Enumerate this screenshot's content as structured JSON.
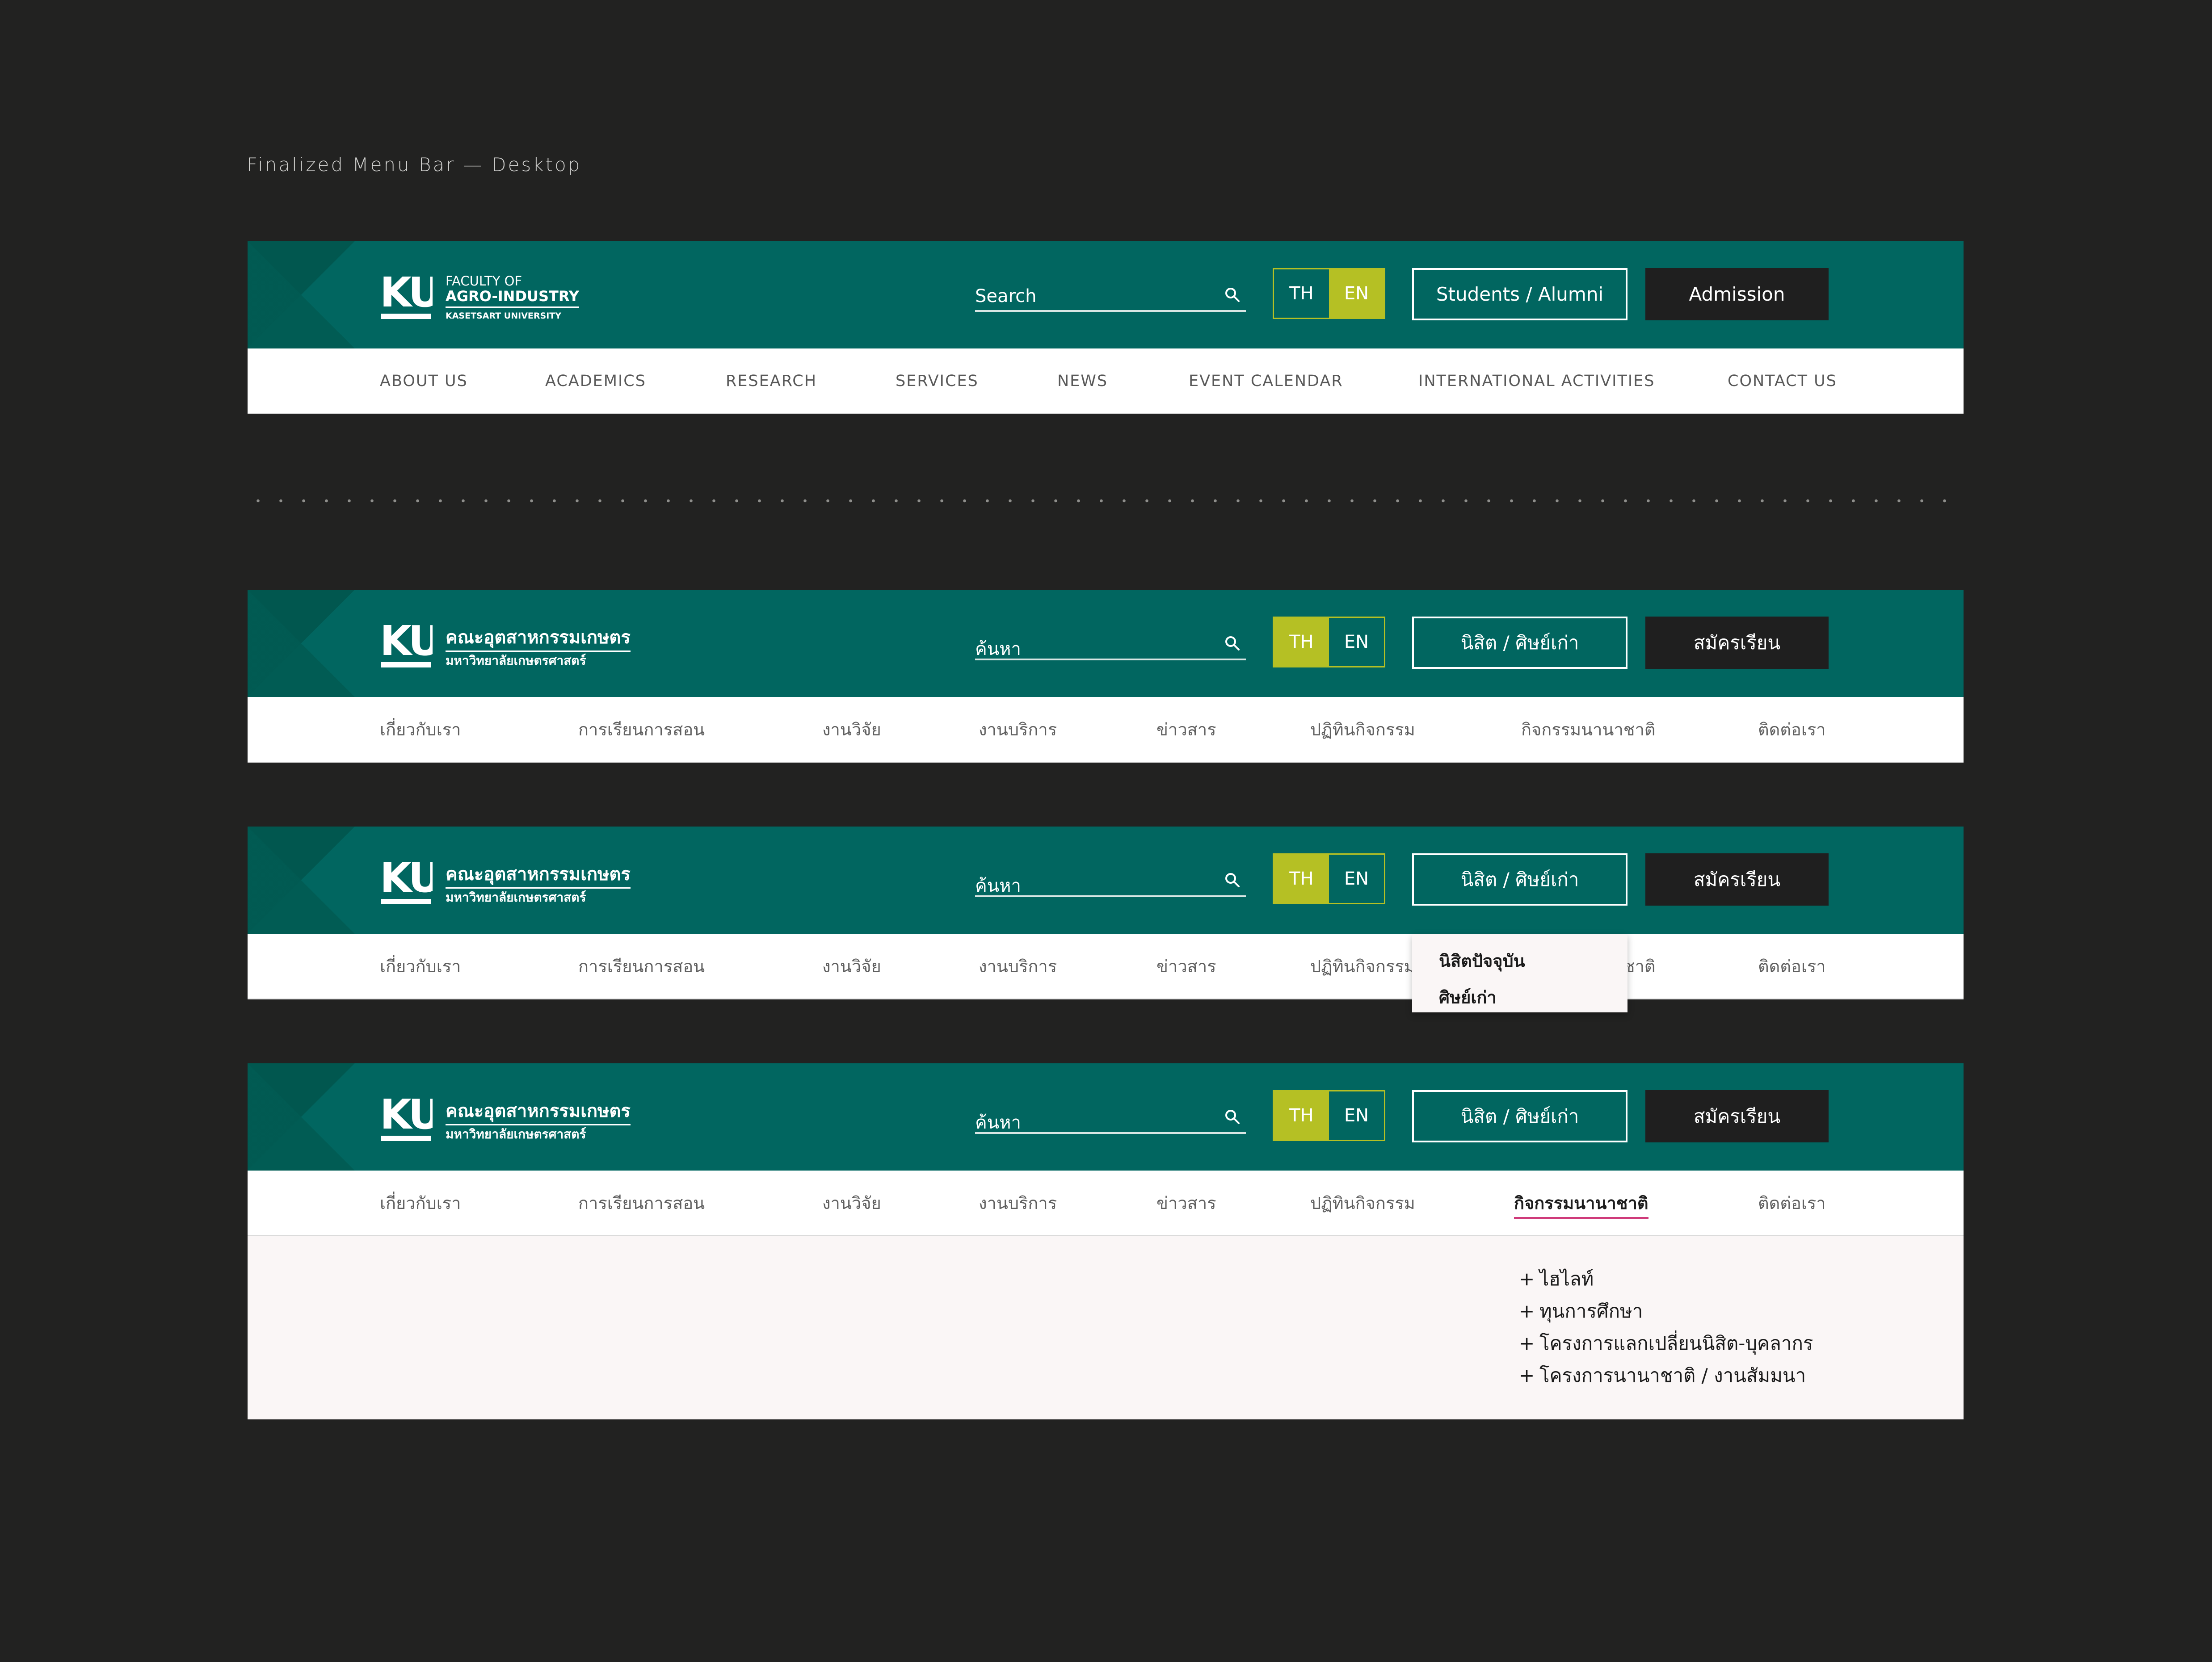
{
  "caption": "Finalized Menu Bar — Desktop",
  "colors": {
    "page_bg": "#222221",
    "header_bg": "#016660",
    "accent_lime": "#b5c024",
    "dark_button": "#1f1f1f",
    "active_underline": "#cf3a7a",
    "dropdown_bg": "#faf6f6"
  },
  "logo": {
    "mark": "KU"
  },
  "bars": [
    {
      "lang": "en",
      "logo_lines": [
        "FACULTY OF",
        "AGRO-INDUSTRY",
        "KASETSART UNIVERSITY"
      ],
      "search_placeholder": "Search",
      "lang_toggle": {
        "th": "TH",
        "en": "EN",
        "active": "EN"
      },
      "secondary_button": "Students / Alumni",
      "primary_button": "Admission",
      "nav": [
        "ABOUT US",
        "ACADEMICS",
        "RESEARCH",
        "SERVICES",
        "NEWS",
        "EVENT CALENDAR",
        "INTERNATIONAL ACTIVITIES",
        "CONTACT US"
      ]
    },
    {
      "lang": "th",
      "logo_lines": [
        "คณะอุตสาหกรรมเกษตร",
        "มหาวิทยาลัยเกษตรศาสตร์"
      ],
      "search_placeholder": "ค้นหา",
      "lang_toggle": {
        "th": "TH",
        "en": "EN",
        "active": "TH"
      },
      "secondary_button": "นิสิต / ศิษย์เก่า",
      "primary_button": "สมัครเรียน",
      "nav": [
        "เกี่ยวกับเรา",
        "การเรียนการสอน",
        "งานวิจัย",
        "งานบริการ",
        "ข่าวสาร",
        "ปฏิทินกิจกรรม",
        "กิจกรรมนานาชาติ",
        "ติดต่อเรา"
      ]
    },
    {
      "lang": "th",
      "logo_lines": [
        "คณะอุตสาหกรรมเกษตร",
        "มหาวิทยาลัยเกษตรศาสตร์"
      ],
      "search_placeholder": "ค้นหา",
      "lang_toggle": {
        "th": "TH",
        "en": "EN",
        "active": "TH"
      },
      "secondary_button": "นิสิต / ศิษย์เก่า",
      "primary_button": "สมัครเรียน",
      "nav": [
        "เกี่ยวกับเรา",
        "การเรียนการสอน",
        "งานวิจัย",
        "งานบริการ",
        "ข่าวสาร",
        "ปฏิทินกิจกรรม",
        "กิจกรรมนานาชาติ",
        "ติดต่อเรา"
      ],
      "dropdown": [
        "นิสิตปัจจุบัน",
        "ศิษย์เก่า"
      ]
    },
    {
      "lang": "th",
      "logo_lines": [
        "คณะอุตสาหกรรมเกษตร",
        "มหาวิทยาลัยเกษตรศาสตร์"
      ],
      "search_placeholder": "ค้นหา",
      "lang_toggle": {
        "th": "TH",
        "en": "EN",
        "active": "TH"
      },
      "secondary_button": "นิสิต / ศิษย์เก่า",
      "primary_button": "สมัครเรียน",
      "nav": [
        "เกี่ยวกับเรา",
        "การเรียนการสอน",
        "งานวิจัย",
        "งานบริการ",
        "ข่าวสาร",
        "ปฏิทินกิจกรรม",
        "กิจกรรมนานาชาติ",
        "ติดต่อเรา"
      ],
      "active_nav": "กิจกรรมนานาชาติ",
      "mega_menu": [
        "ไฮไลท์",
        "ทุนการศึกษา",
        "โครงการแลกเปลี่ยนนิสิต-บุคลากร",
        "โครงการนานาชาติ / งานสัมมนา"
      ]
    }
  ]
}
